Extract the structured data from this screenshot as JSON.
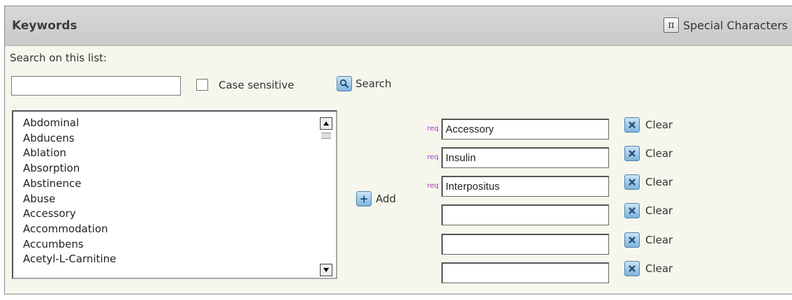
{
  "header": {
    "title": "Keywords",
    "special_chars_icon": "π",
    "special_chars_label": "Special Characters"
  },
  "search": {
    "label": "Search on this list:",
    "value": "",
    "case_sensitive_label": "Case sensitive",
    "case_sensitive_checked": false,
    "button_label": "Search"
  },
  "list": {
    "items": [
      "Abdominal",
      "Abducens",
      "Ablation",
      "Absorption",
      "Abstinence",
      "Abuse",
      "Accessory",
      "Accommodation",
      "Accumbens",
      "Acetyl-L-Carnitine"
    ]
  },
  "add_label": "Add",
  "selected": {
    "req_label": "req",
    "clear_label": "Clear",
    "slots": [
      {
        "value": "Accessory",
        "required": true
      },
      {
        "value": "Insulin",
        "required": true
      },
      {
        "value": "Interpositus",
        "required": true
      },
      {
        "value": "",
        "required": false
      },
      {
        "value": "",
        "required": false
      },
      {
        "value": "",
        "required": false
      }
    ]
  },
  "colors": {
    "panel_bg": "#f6f6ec",
    "header_bg": "#c9c9c9",
    "req_color": "#a040c0",
    "icon_blue": "#7fb3dc"
  }
}
